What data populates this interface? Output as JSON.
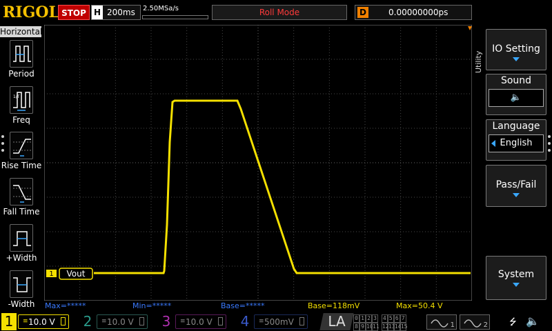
{
  "topbar": {
    "logo": "RIGOL",
    "run_state": "STOP",
    "timebase_label": "H",
    "timebase_value": "200ms",
    "sample_rate": "2.50MSa/s",
    "mode": "Roll Mode",
    "delay_label": "D",
    "delay_value": "0.00000000ps"
  },
  "left_panel": {
    "title": "Horizontal",
    "items": [
      {
        "label": "Period",
        "icon": "period-icon"
      },
      {
        "label": "Freq",
        "icon": "frequency-icon"
      },
      {
        "label": "Rise Time",
        "icon": "rise-time-icon"
      },
      {
        "label": "Fall Time",
        "icon": "fall-time-icon"
      },
      {
        "label": "+Width",
        "icon": "positive-width-icon"
      },
      {
        "label": "-Width",
        "icon": "negative-width-icon"
      }
    ]
  },
  "right_panel": {
    "side_label": "Utility",
    "io_setting": "IO Setting",
    "sound_title": "Sound",
    "language_title": "Language",
    "language_value": "English",
    "pass_fail": "Pass/Fail",
    "system": "System"
  },
  "waveform": {
    "channel_marker": "1",
    "label": "Vout",
    "color": "#f4e000"
  },
  "measurements": {
    "max_blue": "Max=*****",
    "min_blue": "Min=*****",
    "base_blue": "Base=*****",
    "base_yellow": "Base=118mV",
    "max_yellow": "Max=50.4 V"
  },
  "channels": [
    {
      "num": "1",
      "scale": "10.0 V",
      "color": "#f4e000"
    },
    {
      "num": "2",
      "scale": "10.0 V",
      "color": "#2a9a8a"
    },
    {
      "num": "3",
      "scale": "10.0 V",
      "color": "#b030b0"
    },
    {
      "num": "4",
      "scale": "500mV",
      "color": "#2a4aaa"
    }
  ],
  "logic_analyzer": {
    "label": "LA",
    "row1": [
      "0",
      "1",
      "2",
      "3",
      "4",
      "5",
      "6",
      "7"
    ],
    "row2": [
      "8",
      "9",
      "10",
      "11",
      "12",
      "13",
      "14",
      "15"
    ]
  },
  "generators": [
    "1",
    "2"
  ],
  "colors": {
    "stop": "#c00000",
    "accent_blue": "#3aa8ff",
    "logo": "#f4c000",
    "delay": "#f08000"
  }
}
